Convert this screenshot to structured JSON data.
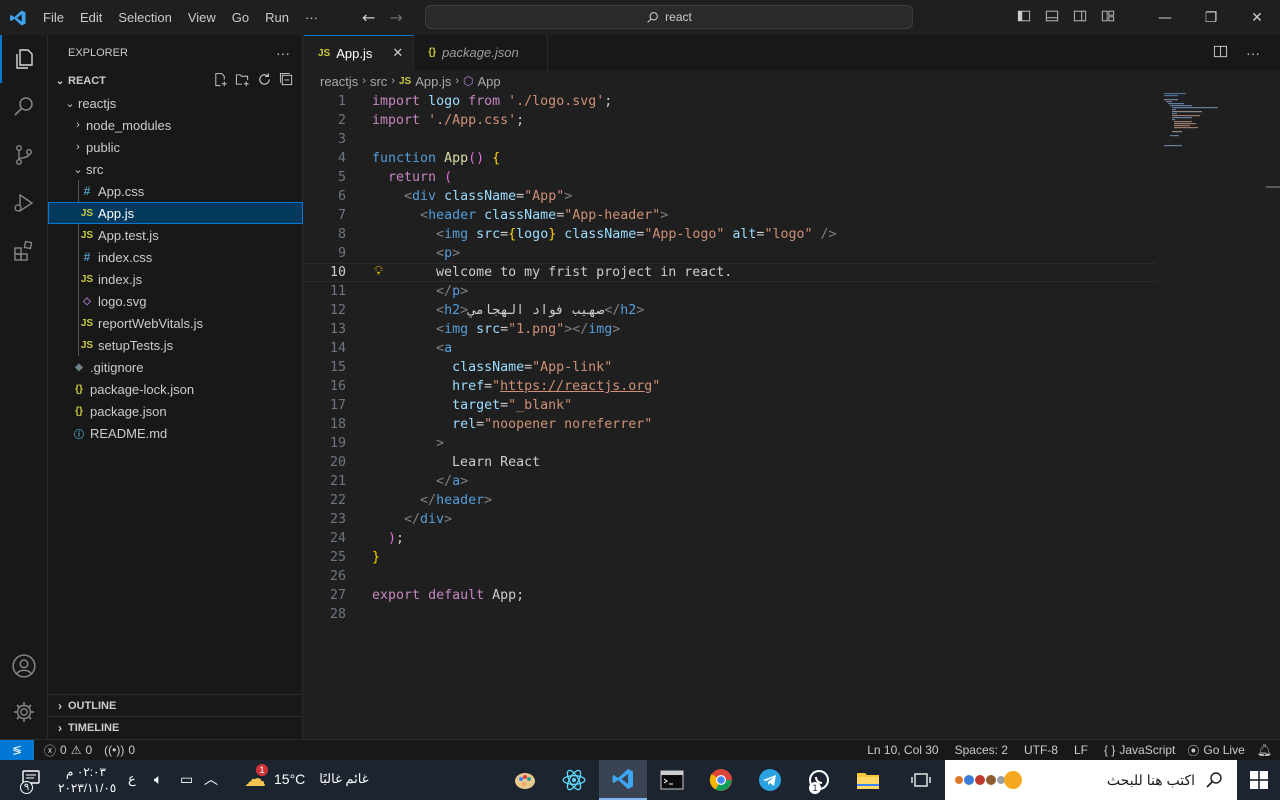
{
  "titlebar": {
    "menu": [
      "File",
      "Edit",
      "Selection",
      "View",
      "Go",
      "Run",
      "···"
    ],
    "search_text": "react"
  },
  "sidebar": {
    "title": "EXPLORER",
    "more": "···",
    "root": "REACT",
    "tree": [
      {
        "label": "reactjs",
        "type": "folder-open",
        "icon": "",
        "depth": 1
      },
      {
        "label": "node_modules",
        "type": "folder",
        "icon": "",
        "depth": 2
      },
      {
        "label": "public",
        "type": "folder",
        "icon": "",
        "depth": 2
      },
      {
        "label": "src",
        "type": "folder-open",
        "icon": "",
        "depth": 2
      },
      {
        "label": "App.css",
        "type": "file",
        "icon": "#",
        "depth": 3
      },
      {
        "label": "App.js",
        "type": "file",
        "icon": "JS",
        "depth": 3,
        "selected": true
      },
      {
        "label": "App.test.js",
        "type": "file",
        "icon": "JS",
        "depth": 3
      },
      {
        "label": "index.css",
        "type": "file",
        "icon": "#",
        "depth": 3
      },
      {
        "label": "index.js",
        "type": "file",
        "icon": "JS",
        "depth": 3
      },
      {
        "label": "logo.svg",
        "type": "file",
        "icon": "◇",
        "depth": 3
      },
      {
        "label": "reportWebVitals.js",
        "type": "file",
        "icon": "JS",
        "depth": 3
      },
      {
        "label": "setupTests.js",
        "type": "file",
        "icon": "JS",
        "depth": 3
      },
      {
        "label": ".gitignore",
        "type": "file",
        "icon": "◆",
        "depth": 2
      },
      {
        "label": "package-lock.json",
        "type": "file",
        "icon": "{}",
        "depth": 2
      },
      {
        "label": "package.json",
        "type": "file",
        "icon": "{}",
        "depth": 2
      },
      {
        "label": "README.md",
        "type": "file",
        "icon": "ⓘ",
        "depth": 2
      }
    ],
    "outline": "OUTLINE",
    "timeline": "TIMELINE"
  },
  "tabs": [
    {
      "label": "App.js",
      "icon": "JS",
      "active": true
    },
    {
      "label": "package.json",
      "icon": "{}",
      "active": false
    }
  ],
  "breadcrumb": [
    "reactjs",
    "src",
    "App.js",
    "App"
  ],
  "editor": {
    "current_line": 10,
    "lines": [
      "import logo from './logo.svg';",
      "import './App.css';",
      "",
      "function App() {",
      "  return (",
      "    <div className=\"App\">",
      "      <header className=\"App-header\">",
      "        <img src={logo} className=\"App-logo\" alt=\"logo\" />",
      "        <p>",
      "        welcome to my frist project in react.",
      "        </p>",
      "        <h2>صهيب فواد الهجامي</h2>",
      "        <img src=\"1.png\"></img>",
      "        <a",
      "          className=\"App-link\"",
      "          href=\"https://reactjs.org\"",
      "          target=\"_blank\"",
      "          rel=\"noopener noreferrer\"",
      "        >",
      "          Learn React",
      "        </a>",
      "      </header>",
      "    </div>",
      "  );",
      "}",
      "",
      "export default App;",
      ""
    ]
  },
  "statusbar": {
    "errors": "0",
    "warnings": "0",
    "ports": "0",
    "position": "Ln 10, Col 30",
    "spaces": "Spaces: 2",
    "encoding": "UTF-8",
    "eol": "LF",
    "language": "JavaScript",
    "golive": "Go Live"
  },
  "taskbar": {
    "search_placeholder": "اكتب هنا للبحث",
    "weather_temp": "15°C",
    "weather_text": "غائم غالبًا",
    "time": "٠٢:٠٣ م",
    "date": "٢٠٢٣/١١/٠٥",
    "lang": "ع",
    "notif_count": "٩",
    "weather_badge": "1",
    "app_badge": "1"
  },
  "colors": {
    "accent": "#0078d4",
    "js_icon": "#cbcb41",
    "css_icon": "#519aba"
  }
}
